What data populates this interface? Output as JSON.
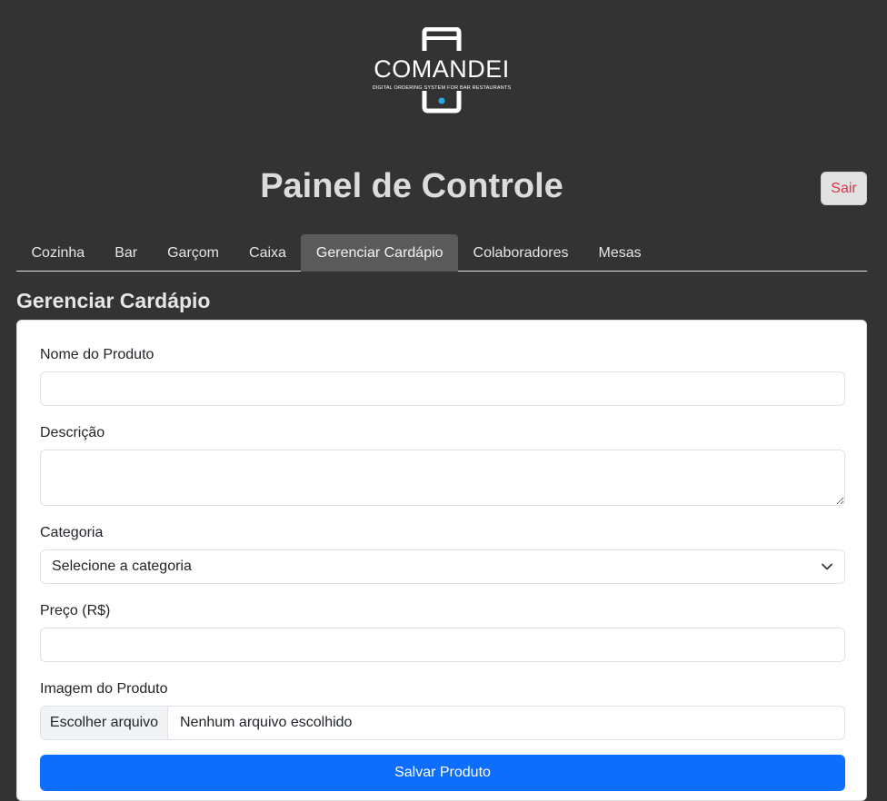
{
  "brand": {
    "name": "COMANDEI",
    "tagline": "DIGITAL ORDERING SYSTEM FOR BAR RESTAURANTS",
    "accent_color": "#29abe2"
  },
  "header": {
    "title": "Painel de Controle",
    "logout_label": "Sair"
  },
  "tabs": [
    {
      "label": "Cozinha",
      "active": false
    },
    {
      "label": "Bar",
      "active": false
    },
    {
      "label": "Garçom",
      "active": false
    },
    {
      "label": "Caixa",
      "active": false
    },
    {
      "label": "Gerenciar Cardápio",
      "active": true
    },
    {
      "label": "Colaboradores",
      "active": false
    },
    {
      "label": "Mesas",
      "active": false
    }
  ],
  "section": {
    "title": "Gerenciar Cardápio"
  },
  "form": {
    "product_name_label": "Nome do Produto",
    "product_name_value": "",
    "description_label": "Descrição",
    "description_value": "",
    "category_label": "Categoria",
    "category_selected": "Selecione a categoria",
    "price_label": "Preço (R$)",
    "price_value": "",
    "image_label": "Imagem do Produto",
    "file_button_label": "Escolher arquivo",
    "file_status": "Nenhum arquivo escolhido",
    "submit_label": "Salvar Produto"
  },
  "colors": {
    "background": "#333333",
    "primary": "#0d6efd",
    "danger": "#dc3545"
  }
}
